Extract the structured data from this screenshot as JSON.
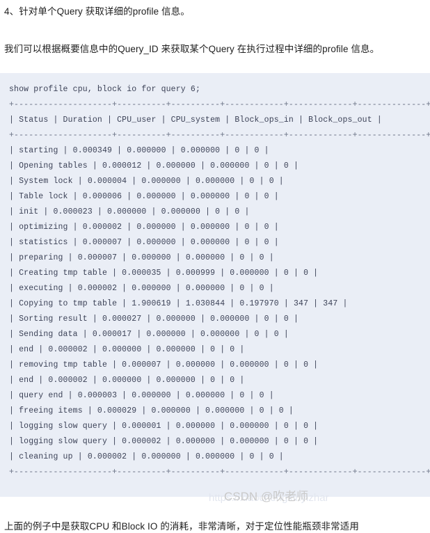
{
  "page": {
    "heading": "4、针对单个Query 获取详细的profile 信息。",
    "intro": "我们可以根据概要信息中的Query_ID 来获取某个Query 在执行过程中详细的profile 信息。",
    "footer": "上面的例子中是获取CPU 和Block IO 的消耗，非常清晰，对于定位性能瓶颈非常适用"
  },
  "watermark": {
    "brand": "CSDN @吹老师",
    "url": "https://xiaochengxinyizhar"
  },
  "colors": {
    "page_background": "#ffffff",
    "code_background": "#eaeef6",
    "code_text": "#3c4257",
    "body_text": "#1f1f1f",
    "watermark": "#c9c9c9"
  },
  "code_block": {
    "command": "show profile cpu, block io for query 6;",
    "separator": "+--------------------+----------+----------+------------+-------------+--------------+",
    "header_row": "| Status | Duration | CPU_user | CPU_system | Block_ops_in | Block_ops_out |",
    "lines": [
      "show profile cpu, block io for query 6;",
      "+--------------------+----------+----------+------------+-------------+--------------+",
      "| Status | Duration | CPU_user | CPU_system | Block_ops_in | Block_ops_out |",
      "+--------------------+----------+----------+------------+-------------+--------------+",
      "| starting | 0.000349 | 0.000000 | 0.000000 | 0 | 0 |",
      "| Opening tables | 0.000012 | 0.000000 | 0.000000 | 0 | 0 |",
      "| System lock | 0.000004 | 0.000000 | 0.000000 | 0 | 0 |",
      "| Table lock | 0.000006 | 0.000000 | 0.000000 | 0 | 0 |",
      "| init | 0.000023 | 0.000000 | 0.000000 | 0 | 0 |",
      "| optimizing | 0.000002 | 0.000000 | 0.000000 | 0 | 0 |",
      "| statistics | 0.000007 | 0.000000 | 0.000000 | 0 | 0 |",
      "| preparing | 0.000007 | 0.000000 | 0.000000 | 0 | 0 |",
      "| Creating tmp table | 0.000035 | 0.000999 | 0.000000 | 0 | 0 |",
      "| executing | 0.000002 | 0.000000 | 0.000000 | 0 | 0 |",
      "| Copying to tmp table | 1.900619 | 1.030844 | 0.197970 | 347 | 347 |",
      "| Sorting result | 0.000027 | 0.000000 | 0.000000 | 0 | 0 |",
      "| Sending data | 0.000017 | 0.000000 | 0.000000 | 0 | 0 |",
      "| end | 0.000002 | 0.000000 | 0.000000 | 0 | 0 |",
      "| removing tmp table | 0.000007 | 0.000000 | 0.000000 | 0 | 0 |",
      "| end | 0.000002 | 0.000000 | 0.000000 | 0 | 0 |",
      "| query end | 0.000003 | 0.000000 | 0.000000 | 0 | 0 |",
      "| freeing items | 0.000029 | 0.000000 | 0.000000 | 0 | 0 |",
      "| logging slow query | 0.000001 | 0.000000 | 0.000000 | 0 | 0 |",
      "| logging slow query | 0.000002 | 0.000000 | 0.000000 | 0 | 0 |",
      "| cleaning up | 0.000002 | 0.000000 | 0.000000 | 0 | 0 |",
      "+--------------------+----------+----------+------------+-------------+--------------+"
    ],
    "columns": [
      "Status",
      "Duration",
      "CPU_user",
      "CPU_system",
      "Block_ops_in",
      "Block_ops_out"
    ],
    "rows": [
      [
        "starting",
        "0.000349",
        "0.000000",
        "0.000000",
        "0",
        "0"
      ],
      [
        "Opening tables",
        "0.000012",
        "0.000000",
        "0.000000",
        "0",
        "0"
      ],
      [
        "System lock",
        "0.000004",
        "0.000000",
        "0.000000",
        "0",
        "0"
      ],
      [
        "Table lock",
        "0.000006",
        "0.000000",
        "0.000000",
        "0",
        "0"
      ],
      [
        "init",
        "0.000023",
        "0.000000",
        "0.000000",
        "0",
        "0"
      ],
      [
        "optimizing",
        "0.000002",
        "0.000000",
        "0.000000",
        "0",
        "0"
      ],
      [
        "statistics",
        "0.000007",
        "0.000000",
        "0.000000",
        "0",
        "0"
      ],
      [
        "preparing",
        "0.000007",
        "0.000000",
        "0.000000",
        "0",
        "0"
      ],
      [
        "Creating tmp table",
        "0.000035",
        "0.000999",
        "0.000000",
        "0",
        "0"
      ],
      [
        "executing",
        "0.000002",
        "0.000000",
        "0.000000",
        "0",
        "0"
      ],
      [
        "Copying to tmp table",
        "1.900619",
        "1.030844",
        "0.197970",
        "347",
        "347"
      ],
      [
        "Sorting result",
        "0.000027",
        "0.000000",
        "0.000000",
        "0",
        "0"
      ],
      [
        "Sending data",
        "0.000017",
        "0.000000",
        "0.000000",
        "0",
        "0"
      ],
      [
        "end",
        "0.000002",
        "0.000000",
        "0.000000",
        "0",
        "0"
      ],
      [
        "removing tmp table",
        "0.000007",
        "0.000000",
        "0.000000",
        "0",
        "0"
      ],
      [
        "end",
        "0.000002",
        "0.000000",
        "0.000000",
        "0",
        "0"
      ],
      [
        "query end",
        "0.000003",
        "0.000000",
        "0.000000",
        "0",
        "0"
      ],
      [
        "freeing items",
        "0.000029",
        "0.000000",
        "0.000000",
        "0",
        "0"
      ],
      [
        "logging slow query",
        "0.000001",
        "0.000000",
        "0.000000",
        "0",
        "0"
      ],
      [
        "logging slow query",
        "0.000002",
        "0.000000",
        "0.000000",
        "0",
        "0"
      ],
      [
        "cleaning up",
        "0.000002",
        "0.000000",
        "0.000000",
        "0",
        "0"
      ]
    ]
  }
}
